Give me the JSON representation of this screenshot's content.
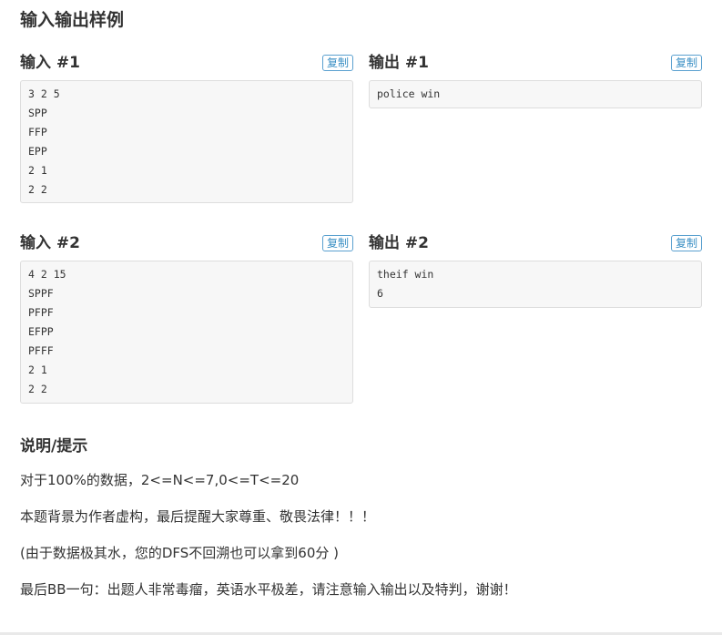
{
  "section": {
    "title": "输入输出样例"
  },
  "samples": [
    {
      "input_label": "输入 #1",
      "output_label": "输出 #1",
      "copy_label": "复制",
      "input_lines": [
        "3 2 5",
        "SPP",
        "FFP",
        "EPP",
        "2 1",
        "2 2"
      ],
      "output_lines": [
        "police win"
      ]
    },
    {
      "input_label": "输入 #2",
      "output_label": "输出 #2",
      "copy_label": "复制",
      "input_lines": [
        "4 2 15",
        "SPPF",
        "PFPF",
        "EFPP",
        "PFFF",
        "2 1",
        "2 2"
      ],
      "output_lines": [
        "theif win",
        "6"
      ]
    }
  ],
  "hints": {
    "title": "说明/提示",
    "lines": [
      "对于100%的数据，2<=N<=7,0<=T<=20",
      "本题背景为作者虚构，最后提醒大家尊重、敬畏法律！！！",
      "(由于数据极其水，您的DFS不回溯也可以拿到60分 )",
      "最后BB一句：出题人非常毒瘤，英语水平极差，请注意输入输出以及特判，谢谢！"
    ]
  }
}
